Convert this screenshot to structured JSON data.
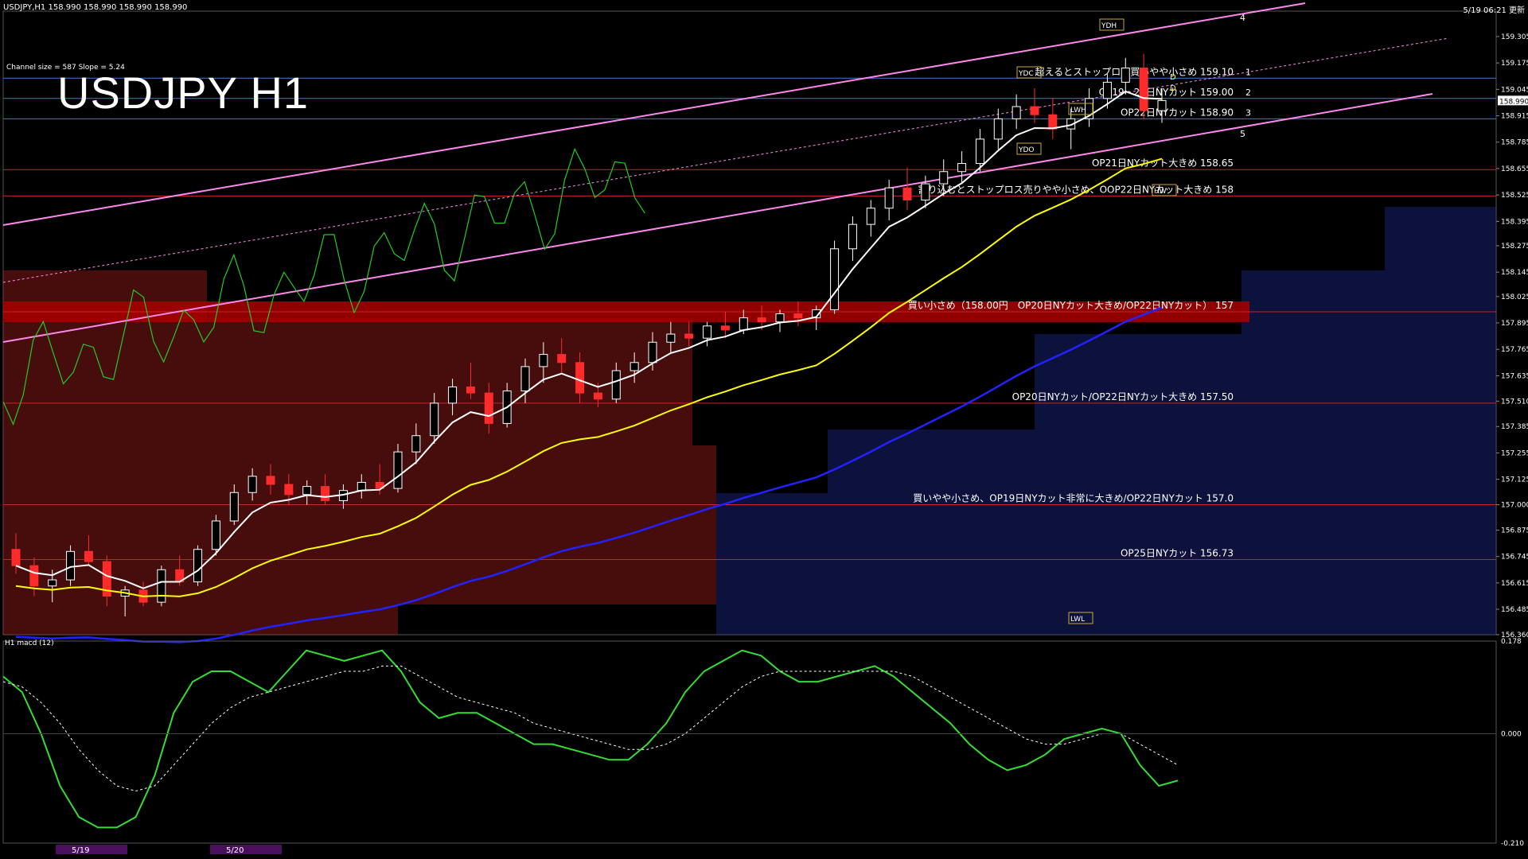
{
  "header": {
    "symbol_line": "USDJPY,H1  158.990 158.990 158.990 158.990",
    "time": "5/19 06:21 更新",
    "channel_info": "Channel size = 587 Slope = 5.24",
    "big_title": "USDJPY H1",
    "macd_title": "H1  macd (12)"
  },
  "colors": {
    "background": "#000000",
    "candle_up": "#ffffff",
    "candle_down": "#ff2a2a",
    "channel": "#ff88ee",
    "ema_white": "#ffffff",
    "ema_yellow": "#ffff00",
    "ema_blue": "#2222ff",
    "rsi_green": "#22cc22",
    "macd_green": "#33dd33",
    "macd_pink": "#ff8899",
    "cloud_red": "#cc2222",
    "cloud_blue": "#2233aa",
    "level_line": "#cc2222",
    "band": "#aa0000"
  },
  "chart_data": {
    "type": "candlestick",
    "symbol": "USDJPY",
    "timeframe": "H1",
    "ylim": [
      156.36,
      159.43
    ],
    "x_ticks": [
      "5/19",
      "5/20"
    ],
    "y_ticks": [
      159.305,
      159.175,
      159.045,
      158.915,
      158.785,
      158.655,
      158.525,
      158.395,
      158.275,
      158.145,
      158.025,
      157.895,
      157.765,
      157.635,
      157.51,
      157.385,
      157.255,
      157.125,
      157.0,
      156.875,
      156.745,
      156.615,
      156.485,
      156.36
    ],
    "current_price": 158.99,
    "levels": [
      {
        "price": 159.1,
        "label": "超えるとストップロス買いやや小さめ 159.10",
        "num": "1"
      },
      {
        "price": 159.0,
        "label": "OP19・21日NYカット 159.00",
        "num": "2"
      },
      {
        "price": 158.9,
        "label": "OP22日NYカット 158.90",
        "num": "3"
      },
      {
        "price": 158.65,
        "label": "OP21日NYカット大きめ 158.65",
        "num": ""
      },
      {
        "price": 158.52,
        "label": "割り込むとストップロス売りやや小さめ、OOP22日NYカット大きめ 158",
        "num": ""
      },
      {
        "price": 157.95,
        "label": "買い小さめ（158.00円　OP20日NYカット大きめ/OP22日NYカット） 157",
        "num": ""
      },
      {
        "price": 157.5,
        "label": "OP20日NYカット/OP22日NYカット大きめ 157.50",
        "num": ""
      },
      {
        "price": 157.0,
        "label": "買いやや小さめ、OP19日NYカット非常に大きめ/OP22日NYカット 157.0",
        "num": ""
      },
      {
        "price": 156.73,
        "label": "OP25日NYカット 156.73",
        "num": ""
      }
    ],
    "channel_numbers": [
      "4",
      "5"
    ],
    "markers": [
      "YDH",
      "YDC",
      "YDO",
      "LWH",
      "LWL",
      "HW"
    ],
    "marker_letters": [
      "D",
      "D"
    ],
    "macd": {
      "name": "macd (12)",
      "ylim": [
        -0.21,
        0.178
      ],
      "y_ticks": [
        0.178,
        0.0,
        -0.21
      ],
      "values": [
        0.11,
        0.08,
        0.0,
        -0.1,
        -0.16,
        -0.18,
        -0.18,
        -0.16,
        -0.08,
        0.04,
        0.1,
        0.12,
        0.12,
        0.1,
        0.08,
        0.12,
        0.16,
        0.15,
        0.14,
        0.15,
        0.16,
        0.12,
        0.06,
        0.03,
        0.04,
        0.04,
        0.02,
        0.0,
        -0.02,
        -0.02,
        -0.03,
        -0.04,
        -0.05,
        -0.05,
        -0.02,
        0.02,
        0.08,
        0.12,
        0.14,
        0.16,
        0.15,
        0.12,
        0.1,
        0.1,
        0.11,
        0.12,
        0.13,
        0.11,
        0.08,
        0.05,
        0.02,
        -0.02,
        -0.05,
        -0.07,
        -0.06,
        -0.04,
        -0.01,
        0.0,
        0.01,
        0.0,
        -0.06,
        -0.1,
        -0.09
      ],
      "signal": [
        0.1,
        0.09,
        0.06,
        0.02,
        -0.03,
        -0.07,
        -0.1,
        -0.11,
        -0.1,
        -0.06,
        -0.02,
        0.02,
        0.05,
        0.07,
        0.08,
        0.09,
        0.1,
        0.11,
        0.12,
        0.12,
        0.13,
        0.13,
        0.11,
        0.09,
        0.07,
        0.06,
        0.05,
        0.04,
        0.02,
        0.01,
        0.0,
        -0.01,
        -0.02,
        -0.03,
        -0.03,
        -0.02,
        0.0,
        0.03,
        0.06,
        0.09,
        0.11,
        0.12,
        0.12,
        0.12,
        0.12,
        0.12,
        0.12,
        0.12,
        0.11,
        0.09,
        0.07,
        0.05,
        0.03,
        0.01,
        -0.01,
        -0.02,
        -0.02,
        -0.01,
        0.0,
        0.0,
        -0.02,
        -0.04,
        -0.06
      ]
    },
    "candles": [
      [
        156.78,
        156.86,
        156.66,
        156.7
      ],
      [
        156.7,
        156.74,
        156.55,
        156.6
      ],
      [
        156.6,
        156.68,
        156.52,
        156.63
      ],
      [
        156.63,
        156.8,
        156.6,
        156.77
      ],
      [
        156.77,
        156.85,
        156.7,
        156.72
      ],
      [
        156.72,
        156.75,
        156.5,
        156.55
      ],
      [
        156.55,
        156.6,
        156.45,
        156.58
      ],
      [
        156.58,
        156.62,
        156.5,
        156.52
      ],
      [
        156.52,
        156.7,
        156.5,
        156.68
      ],
      [
        156.68,
        156.75,
        156.6,
        156.62
      ],
      [
        156.62,
        156.8,
        156.6,
        156.78
      ],
      [
        156.78,
        156.95,
        156.75,
        156.92
      ],
      [
        156.92,
        157.1,
        156.9,
        157.06
      ],
      [
        157.06,
        157.18,
        157.02,
        157.14
      ],
      [
        157.14,
        157.2,
        157.05,
        157.1
      ],
      [
        157.1,
        157.15,
        157.0,
        157.05
      ],
      [
        157.05,
        157.12,
        157.0,
        157.09
      ],
      [
        157.09,
        157.15,
        157.0,
        157.02
      ],
      [
        157.02,
        157.1,
        156.98,
        157.07
      ],
      [
        157.07,
        157.15,
        157.03,
        157.11
      ],
      [
        157.11,
        157.2,
        157.05,
        157.08
      ],
      [
        157.08,
        157.3,
        157.06,
        157.26
      ],
      [
        157.26,
        157.4,
        157.2,
        157.34
      ],
      [
        157.34,
        157.55,
        157.3,
        157.5
      ],
      [
        157.5,
        157.62,
        157.44,
        157.58
      ],
      [
        157.58,
        157.7,
        157.52,
        157.55
      ],
      [
        157.55,
        157.6,
        157.35,
        157.4
      ],
      [
        157.4,
        157.6,
        157.38,
        157.56
      ],
      [
        157.56,
        157.72,
        157.5,
        157.68
      ],
      [
        157.68,
        157.8,
        157.6,
        157.74
      ],
      [
        157.74,
        157.82,
        157.65,
        157.7
      ],
      [
        157.7,
        157.75,
        157.5,
        157.55
      ],
      [
        157.55,
        157.6,
        157.48,
        157.52
      ],
      [
        157.52,
        157.7,
        157.5,
        157.66
      ],
      [
        157.66,
        157.75,
        157.6,
        157.7
      ],
      [
        157.7,
        157.85,
        157.66,
        157.8
      ],
      [
        157.8,
        157.9,
        157.75,
        157.84
      ],
      [
        157.84,
        157.9,
        157.78,
        157.82
      ],
      [
        157.82,
        157.9,
        157.78,
        157.88
      ],
      [
        157.88,
        157.95,
        157.82,
        157.86
      ],
      [
        157.86,
        157.96,
        157.84,
        157.92
      ],
      [
        157.92,
        157.98,
        157.86,
        157.9
      ],
      [
        157.9,
        157.96,
        157.85,
        157.94
      ],
      [
        157.94,
        158.0,
        157.88,
        157.92
      ],
      [
        157.92,
        157.98,
        157.86,
        157.96
      ],
      [
        157.96,
        158.3,
        157.94,
        158.26
      ],
      [
        158.26,
        158.42,
        158.2,
        158.38
      ],
      [
        158.38,
        158.5,
        158.32,
        158.46
      ],
      [
        158.46,
        158.6,
        158.4,
        158.56
      ],
      [
        158.56,
        158.66,
        158.45,
        158.5
      ],
      [
        158.5,
        158.62,
        158.46,
        158.58
      ],
      [
        158.58,
        158.7,
        158.52,
        158.64
      ],
      [
        158.64,
        158.74,
        158.58,
        158.68
      ],
      [
        158.68,
        158.85,
        158.64,
        158.8
      ],
      [
        158.8,
        158.95,
        158.75,
        158.9
      ],
      [
        158.9,
        159.02,
        158.85,
        158.96
      ],
      [
        158.96,
        159.05,
        158.88,
        158.92
      ],
      [
        158.92,
        159.0,
        158.8,
        158.85
      ],
      [
        158.85,
        158.95,
        158.75,
        158.9
      ],
      [
        158.9,
        159.05,
        158.86,
        159.0
      ],
      [
        159.0,
        159.12,
        158.95,
        159.08
      ],
      [
        159.08,
        159.2,
        159.02,
        159.15
      ],
      [
        159.15,
        159.22,
        158.9,
        158.94
      ],
      [
        158.94,
        159.05,
        158.88,
        158.99
      ]
    ]
  }
}
